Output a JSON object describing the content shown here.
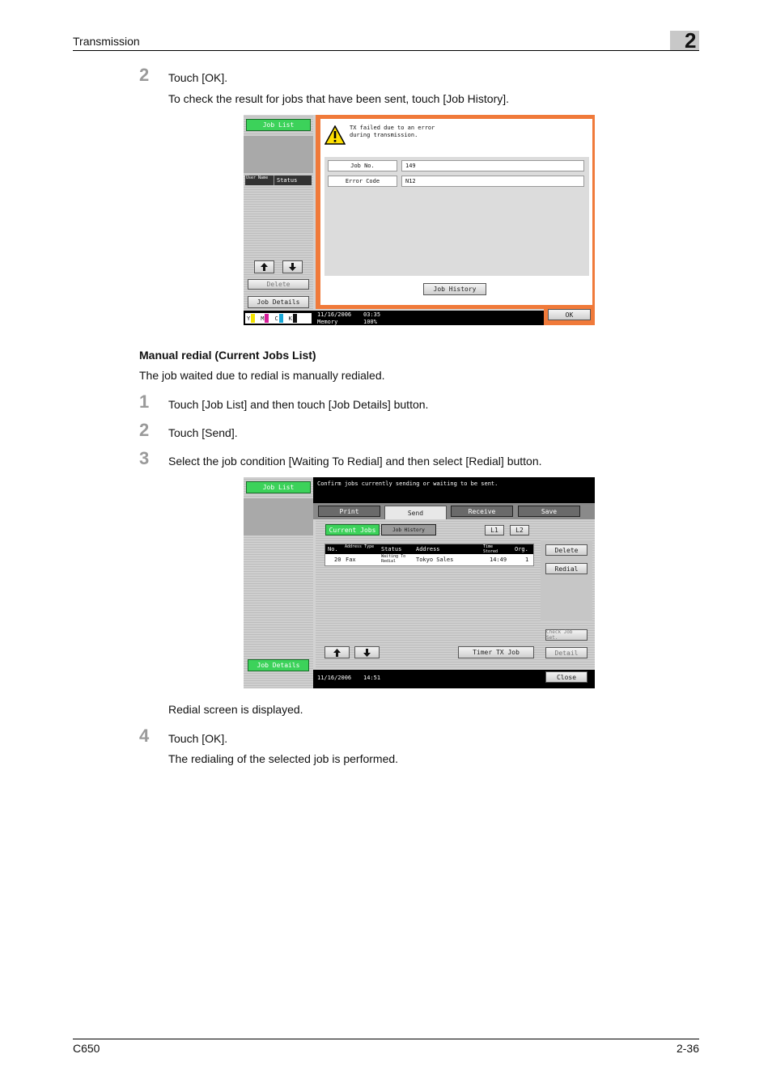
{
  "header": {
    "section": "Transmission",
    "chapter": "2"
  },
  "footer": {
    "model": "C650",
    "page": "2-36"
  },
  "steps": {
    "s2a_num": "2",
    "s2a_text": "Touch [OK].",
    "s2a_note": "To check the result for jobs that have been sent, touch [Job History].",
    "heading": "Manual redial (Current Jobs List)",
    "intro": "The job waited due to redial is manually redialed.",
    "s1_num": "1",
    "s1_text": "Touch [Job List] and then touch [Job Details] button.",
    "s2b_num": "2",
    "s2b_text": "Touch [Send].",
    "s3_num": "3",
    "s3_text": "Select the job condition [Waiting To Redial] and then select [Redial] button.",
    "after3": "Redial screen is displayed.",
    "s4_num": "4",
    "s4_text": "Touch [OK].",
    "after4": "The redialing of the selected job is performed."
  },
  "screen1": {
    "job_list": "Job List",
    "col_user": "User Name",
    "col_status": "Status",
    "delete": "Delete",
    "job_details": "Job Details",
    "msg_line1": "TX failed due to an error",
    "msg_line2": "during transmission.",
    "job_no_label": "Job No.",
    "job_no_value": "149",
    "error_code_label": "Error Code",
    "error_code_value": "N12",
    "job_history": "Job History",
    "ok": "OK",
    "date": "11/16/2006",
    "time": "03:35",
    "memory_label": "Memory",
    "memory_value": "100%",
    "toner": [
      "Y",
      "M",
      "C",
      "K"
    ],
    "toner_colors": [
      "#f2e200",
      "#d81e9a",
      "#18a8d8",
      "#111111"
    ]
  },
  "screen2": {
    "job_list": "Job List",
    "prompt": "Confirm jobs currently sending or waiting to be sent.",
    "tabs": [
      "Print",
      "Send",
      "Receive",
      "Save"
    ],
    "current_jobs": "Current Jobs",
    "job_history": "Job History",
    "l1": "L1",
    "l2": "L2",
    "columns": [
      "No.",
      "Address Type",
      "Status",
      "Address",
      "Time Stored",
      "Org."
    ],
    "row": {
      "no": "20",
      "type": "Fax",
      "status": "Waiting To Redial",
      "address": "Tokyo Sales",
      "time": "14:49",
      "org": "1"
    },
    "delete": "Delete",
    "redial": "Redial",
    "check_job_set": "Check Job Set.",
    "detail": "Detail",
    "timer_tx": "Timer TX Job",
    "job_details": "Job Details",
    "close": "Close",
    "date": "11/16/2006",
    "time": "14:51"
  }
}
